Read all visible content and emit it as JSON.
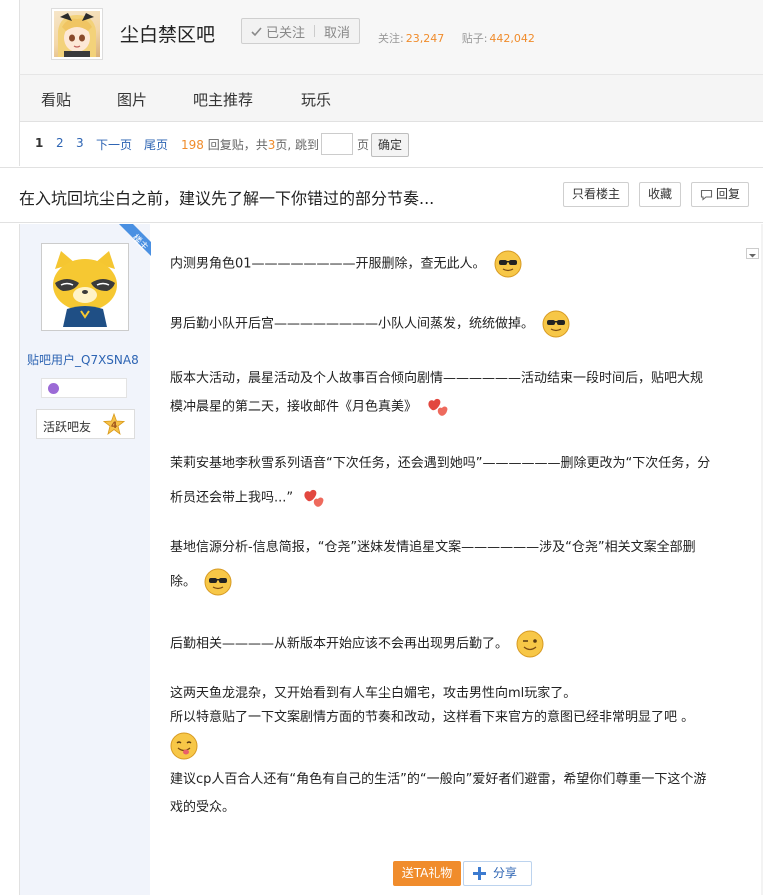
{
  "forum": {
    "name": "尘白禁区吧",
    "follow_label": "已关注",
    "cancel_label": "取消",
    "followers_label": "关注:",
    "followers": "23,247",
    "posts_label": "贴子:",
    "posts": "442,042"
  },
  "nav": {
    "items": [
      "看贴",
      "图片",
      "吧主推荐",
      "玩乐"
    ]
  },
  "pager": {
    "page1": "1",
    "page2": "2",
    "page3": "3",
    "next": "下一页",
    "last": "尾页",
    "reply_count": "198",
    "reply_label": "回复贴，共",
    "total_pages": "3",
    "pages_suffix": "页,",
    "jump_label": "跳到",
    "page_unit": "页",
    "confirm": "确定"
  },
  "thread": {
    "title": "在入坑回坑尘白之前，建议先了解一下你错过的部分节奏...",
    "only_op": "只看楼主",
    "collect": "收藏",
    "reply": "回复"
  },
  "author": {
    "op_badge": "楼主",
    "username": "贴吧用户_Q7XSNA8",
    "level_title": "活跃吧友",
    "level": "4"
  },
  "post": {
    "p1": "内测男角色01————————开服删除，查无此人。",
    "p2": "男后勤小队开后宫————————小队人间蒸发，统统做掉。",
    "p3a": "版本大活动，晨星活动及个人故事百合倾向剧情——————活动结束一段时间后，贴吧大规",
    "p3b": "模冲晨星的第二天，接收邮件《月色真美》",
    "p4a": "茉莉安基地李秋雪系列语音“下次任务，还会遇到她吗”——————删除更改为“下次任务，分",
    "p4b": "析员还会带上我吗...”",
    "p5a": "基地信源分析-信息简报，“仓尧”迷妹发情追星文案——————涉及“仓尧”相关文案全部删",
    "p5b": "除。",
    "p6": "后勤相关————从新版本开始应该不会再出现男后勤了。",
    "p7": "这两天鱼龙混杂，又开始看到有人车尘白媚宅，攻击男性向ml玩家了。",
    "p8": "所以特意贴了一下文案剧情方面的节奏和改动，这样看下来官方的意图已经非常明显了吧 。",
    "p9a": "建议cp人百合人还有“角色有自己的生活”的“一般向”爱好者们避雷，希望你们尊重一下这个游",
    "p9b": "戏的受众。"
  },
  "actions": {
    "gift": "送TA礼物",
    "share": "分享"
  },
  "icons": [
    "forum-avatar-icon",
    "check-icon",
    "cool-emoji-icon",
    "hearts-emoji-icon",
    "wink-emoji-icon",
    "tongue-emoji-icon",
    "comment-icon",
    "plus-icon",
    "star-badge-icon",
    "gem-icon",
    "dropdown-icon"
  ],
  "colors": {
    "accent_orange": "#f08c2c",
    "link_blue": "#2d64b3",
    "side_bg": "#f1f4fb"
  }
}
